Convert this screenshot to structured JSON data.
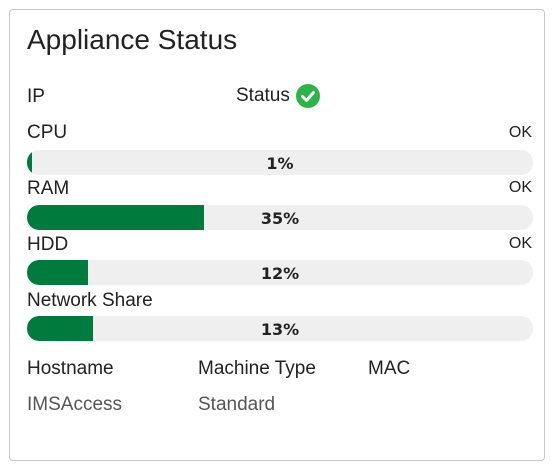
{
  "panel": {
    "title": "Appliance Status",
    "ip_label": "IP",
    "status_label": "Status",
    "status_icon": "check-circle-icon",
    "status_color": "#2db34a"
  },
  "metrics": [
    {
      "label": "CPU",
      "status": "OK",
      "percent": 1,
      "percent_text": "1%"
    },
    {
      "label": "RAM",
      "status": "OK",
      "percent": 35,
      "percent_text": "35%"
    },
    {
      "label": "HDD",
      "status": "OK",
      "percent": 12,
      "percent_text": "12%"
    },
    {
      "label": "Network Share",
      "status": "",
      "percent": 13,
      "percent_text": "13%"
    }
  ],
  "bar_color": "#007a3d",
  "info": {
    "hostname_label": "Hostname",
    "machine_type_label": "Machine Type",
    "mac_label": "MAC",
    "hostname_value": "IMSAccess",
    "machine_type_value": "Standard",
    "mac_value": ""
  }
}
